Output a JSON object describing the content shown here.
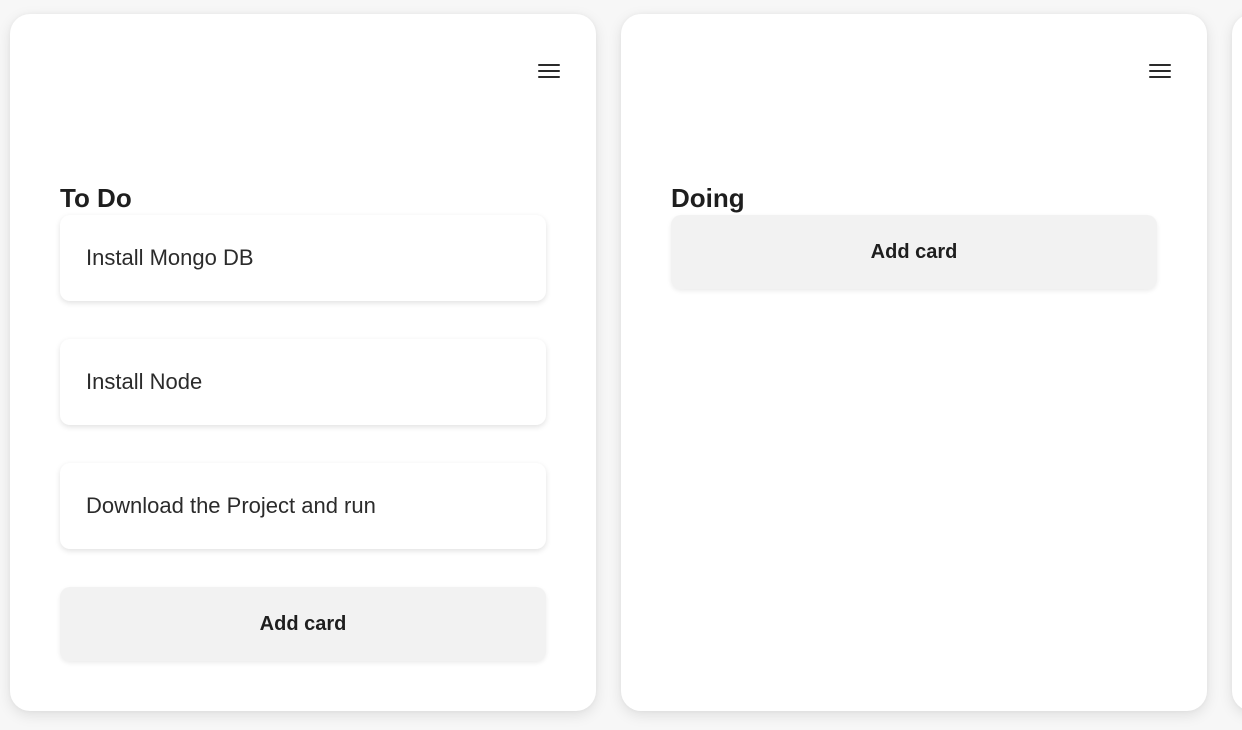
{
  "columns": [
    {
      "title": "To Do",
      "cards": [
        {
          "text": "Install Mongo DB"
        },
        {
          "text": "Install Node"
        },
        {
          "text": "Download the Project and run"
        }
      ],
      "add_label": "Add card",
      "menu_icon": "hamburger-menu-icon"
    },
    {
      "title": "Doing",
      "cards": [],
      "add_label": "Add card",
      "menu_icon": "hamburger-menu-icon"
    }
  ],
  "colors": {
    "page_background": "#f7f7f7",
    "column_background": "#ffffff",
    "add_button_background": "#f2f2f2",
    "text": "#2b2b2b"
  }
}
